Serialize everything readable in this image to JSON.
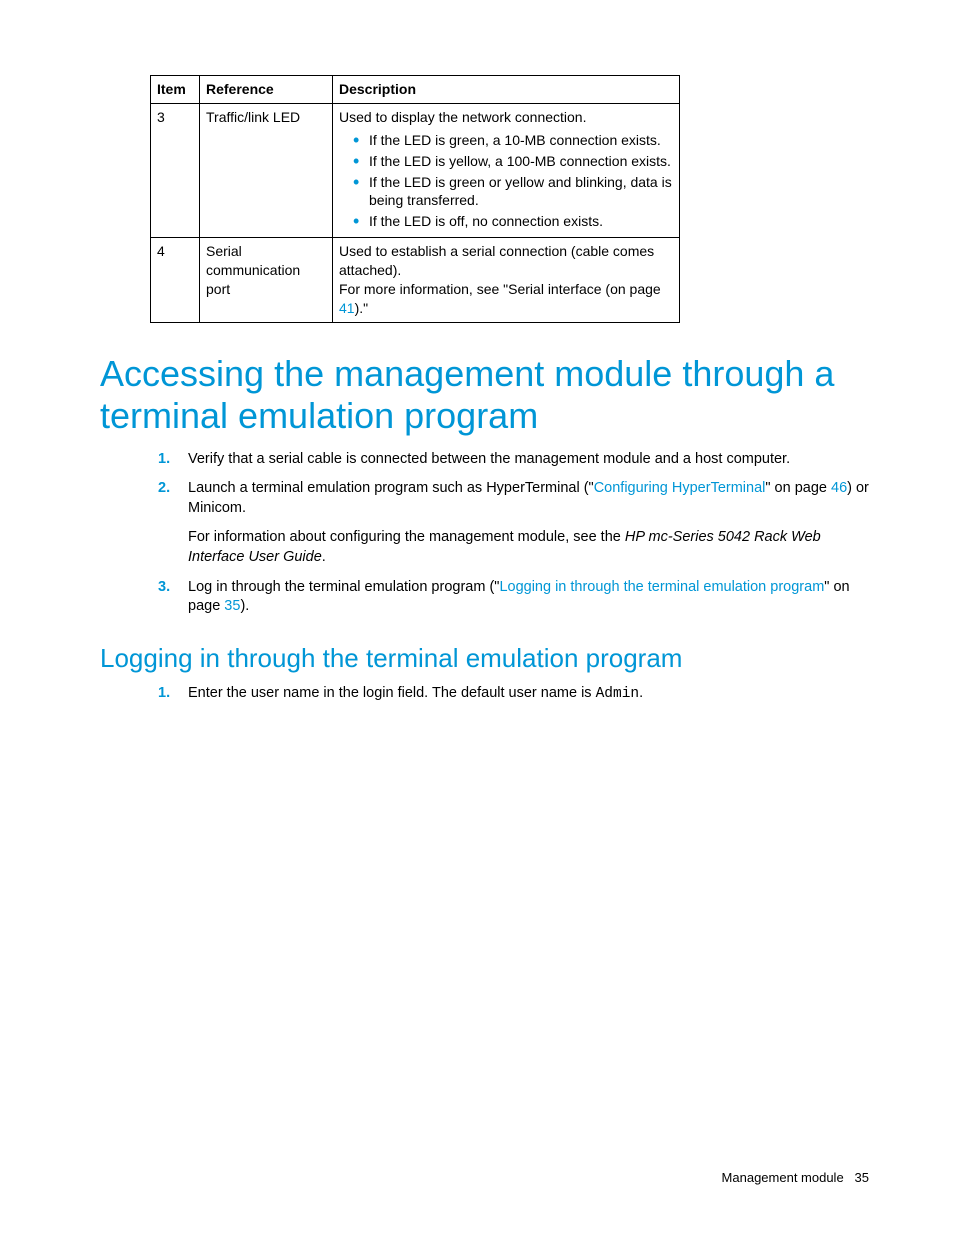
{
  "table": {
    "headers": [
      "Item",
      "Reference",
      "Description"
    ],
    "rows": [
      {
        "item": "3",
        "reference": "Traffic/link LED",
        "desc_intro": "Used to display the network connection.",
        "bullets": [
          "If the LED is green, a 10-MB connection exists.",
          "If the LED is yellow, a 100-MB connection exists.",
          "If the LED is green or yellow and blinking, data is being transferred.",
          "If the LED is off, no connection exists."
        ]
      },
      {
        "item": "4",
        "reference": "Serial communication port",
        "desc_line1": "Used to establish a serial connection (cable comes attached).",
        "desc_line2_pre": "For more information, see \"Serial interface (on page ",
        "desc_line2_link": "41",
        "desc_line2_post": ").\""
      }
    ]
  },
  "h1": "Accessing the management module through a terminal emulation program",
  "steps_main": {
    "s1": "Verify that a serial cable is connected between the management module and a host computer.",
    "s2_pre": "Launch a terminal emulation program such as HyperTerminal (\"",
    "s2_link": "Configuring HyperTerminal",
    "s2_mid": "\" on page ",
    "s2_page": "46",
    "s2_post": ") or Minicom.",
    "s2_para_pre": "For information about configuring the management module, see the ",
    "s2_para_italic": "HP mc-Series 5042 Rack Web Interface User Guide",
    "s2_para_post": ".",
    "s3_pre": "Log in through the terminal emulation program (\"",
    "s3_link": "Logging in through the terminal emulation program",
    "s3_mid": "\" on page ",
    "s3_page": "35",
    "s3_post": ")."
  },
  "h2": "Logging in through the terminal emulation program",
  "steps_sub": {
    "s1_pre": "Enter the user name in the login field. The default user name is ",
    "s1_mono": "Admin",
    "s1_post": "."
  },
  "footer": {
    "section": "Management module",
    "page": "35"
  }
}
